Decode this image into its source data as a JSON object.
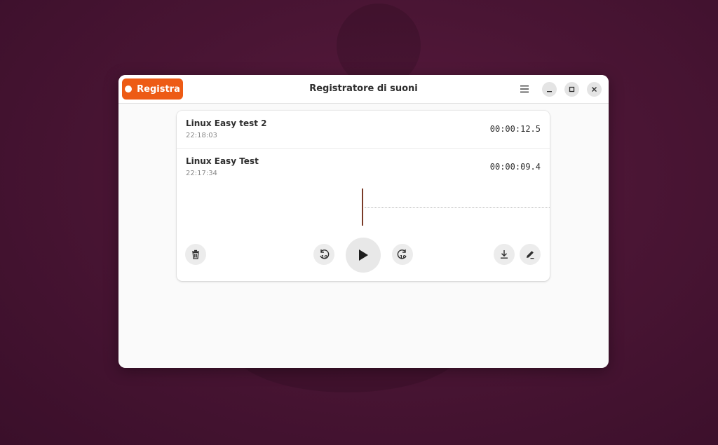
{
  "app": {
    "title": "Registratore di suoni",
    "record_label": "Registra"
  },
  "recordings": [
    {
      "name": "Linux Easy test 2",
      "time": "22:18:03",
      "duration": "00:00:12.5"
    },
    {
      "name": "Linux Easy Test",
      "time": "22:17:34",
      "duration": "00:00:09.4"
    }
  ],
  "icons": {
    "menu": "hamburger-menu-icon",
    "minimize": "minimize-icon",
    "maximize": "maximize-icon",
    "close": "close-icon",
    "delete": "trash-icon",
    "rewind": "seek-back-10-icon",
    "play": "play-icon",
    "forward": "seek-forward-10-icon",
    "export": "download-icon",
    "rename": "edit-icon"
  },
  "colors": {
    "accent": "#ed5b15",
    "playhead": "#7a3b28"
  }
}
